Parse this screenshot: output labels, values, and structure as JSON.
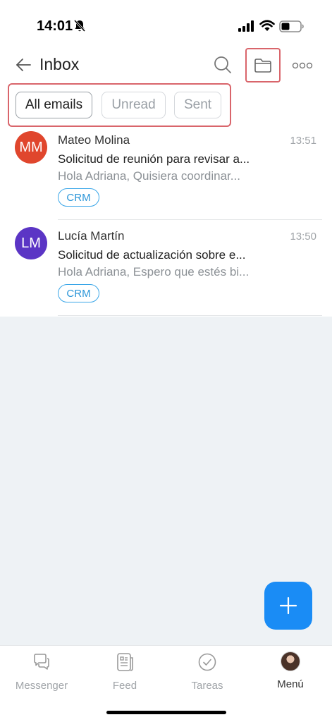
{
  "status_bar": {
    "time": "14:01"
  },
  "header": {
    "title": "Inbox"
  },
  "filters": [
    {
      "label": "All emails",
      "active": true
    },
    {
      "label": "Unread",
      "active": false
    },
    {
      "label": "Sent",
      "active": false
    }
  ],
  "emails": [
    {
      "initials": "MM",
      "avatar_color": "#e0462d",
      "sender": "Mateo Molina",
      "time": "13:51",
      "subject": "Solicitud de reunión para revisar a...",
      "preview": "Hola Adriana, Quisiera coordinar...",
      "tag": "CRM"
    },
    {
      "initials": "LM",
      "avatar_color": "#5b35c5",
      "sender": "Lucía Martín",
      "time": "13:50",
      "subject": "Solicitud de actualización sobre e...",
      "preview": "Hola Adriana, Espero que estés bi...",
      "tag": "CRM"
    }
  ],
  "bottom_nav": {
    "messenger": "Messenger",
    "feed": "Feed",
    "tareas": "Tareas",
    "menu": "Menú"
  },
  "colors": {
    "accent": "#1a8cf5",
    "highlight_border": "#d9656b",
    "tag": "#2a95d8"
  }
}
